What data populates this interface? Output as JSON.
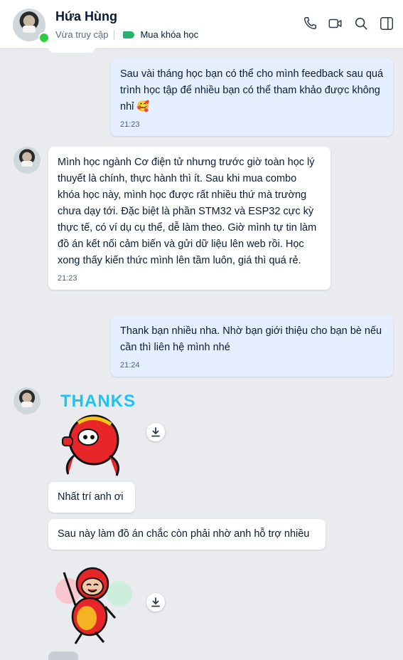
{
  "header": {
    "contact_name": "Hứa Hùng",
    "status": "Vừa truy cập",
    "tag_label": "Mua khóa học",
    "tag_color": "#23b36b",
    "icons": [
      "phone-icon",
      "video-call-icon",
      "search-icon",
      "sidebar-toggle-icon"
    ]
  },
  "messages": [
    {
      "sender": "me",
      "text": "Sau vài tháng học bạn có thể cho mình feedback sau quá trình học tập để nhiều bạn có thể tham khảo được không nhỉ 🥰",
      "time": "21:23"
    },
    {
      "sender": "other",
      "text": "Mình học ngành Cơ điện tử nhưng trước giờ toàn học lý thuyết là chính, thực hành thì ít. Sau khi mua combo khóa học này, mình học được rất nhiều thứ mà trường chưa dạy tới. Đặc biệt là phần STM32 và ESP32 cực kỳ thực tế, có ví dụ cụ thể, dễ làm theo. Giờ mình tự tin làm đồ án kết nối cảm biến và gửi dữ liệu lên web rồi. Học xong thấy kiến thức mình lên tầm luôn, giá thì quá rẻ.",
      "time": "21:23"
    },
    {
      "sender": "me",
      "text": "Thank bạn nhiều nha. Nhờ bạn giới thiệu cho bạn bè nếu cần thì liên hệ mình nhé",
      "time": "21:24"
    },
    {
      "sender": "other",
      "sticker_text": "THANKS"
    },
    {
      "sender": "other",
      "text": "Nhất trí anh ơi"
    },
    {
      "sender": "other",
      "text": "Sau này làm đồ án chắc còn phải nhờ anh hỗ trợ nhiều"
    },
    {
      "sender": "other",
      "sticker": "dancing-character-sticker"
    }
  ],
  "colors": {
    "background": "#e9ebef",
    "my_bubble": "#e5efff",
    "their_bubble": "#ffffff",
    "online": "#2ecc40",
    "sticker_text": "#1ec3f0"
  }
}
